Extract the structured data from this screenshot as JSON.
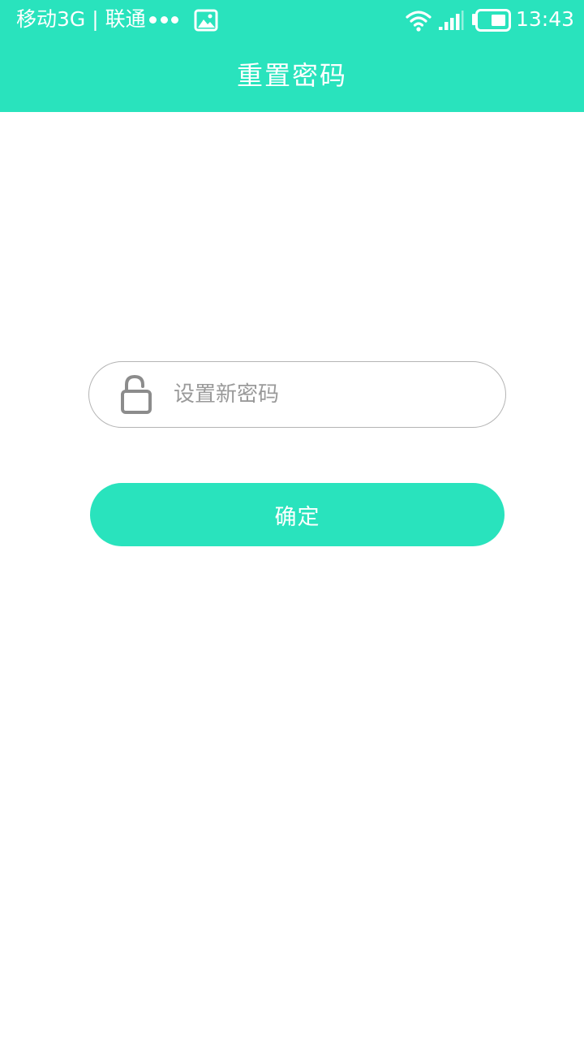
{
  "status_bar": {
    "carrier": "移动3G | 联通",
    "time": "13:43",
    "icons": [
      "more-dots-icon",
      "gallery-icon",
      "wifi-icon",
      "cell-signal-icon",
      "battery-icon"
    ]
  },
  "header": {
    "title": "重置密码"
  },
  "form": {
    "password_placeholder": "设置新密码",
    "password_value": "",
    "lock_icon": "unlock-icon",
    "confirm_label": "确定"
  },
  "colors": {
    "accent": "#29e3bd",
    "background": "#ffffff",
    "border": "#b4b4b4",
    "placeholder": "#9a9a9a"
  }
}
